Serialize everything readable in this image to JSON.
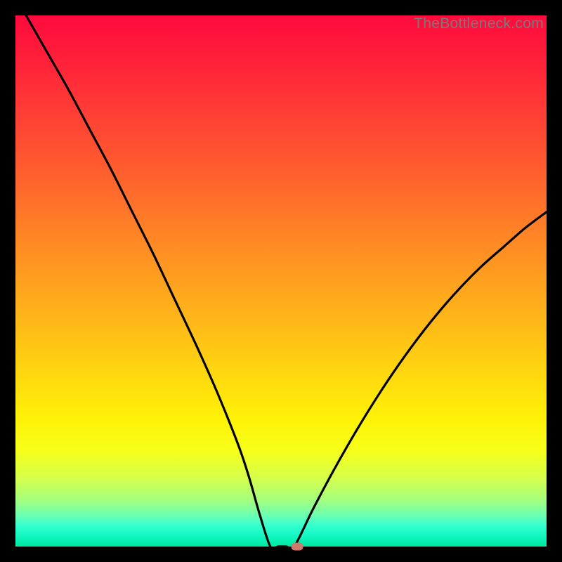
{
  "watermark": "TheBottleneck.com",
  "chart_data": {
    "type": "line",
    "title": "",
    "xlabel": "",
    "ylabel": "",
    "xlim": [
      0,
      100
    ],
    "ylim": [
      0,
      100
    ],
    "series": [
      {
        "name": "left-branch",
        "x": [
          2,
          6,
          10,
          14,
          18,
          22,
          26,
          30,
          34,
          38,
          42,
          44,
          46,
          48
        ],
        "y": [
          100,
          93,
          86,
          78.5,
          71,
          63,
          55,
          46.5,
          38,
          29,
          19,
          13,
          6,
          0
        ]
      },
      {
        "name": "valley-floor",
        "x": [
          48,
          49.5,
          51,
          52.5
        ],
        "y": [
          0,
          0,
          0,
          0
        ]
      },
      {
        "name": "right-branch",
        "x": [
          52.5,
          56,
          60,
          64,
          68,
          72,
          76,
          80,
          84,
          88,
          92,
          96,
          100
        ],
        "y": [
          0,
          7,
          14.5,
          21.5,
          28,
          34,
          39.5,
          44.5,
          49,
          53,
          56.5,
          60,
          63
        ]
      }
    ],
    "marker": {
      "x": 53,
      "y": 0,
      "color": "#cf7a6c"
    },
    "background_gradient": {
      "top": "#ff0a3c",
      "bottom": "#00e8a0"
    }
  }
}
